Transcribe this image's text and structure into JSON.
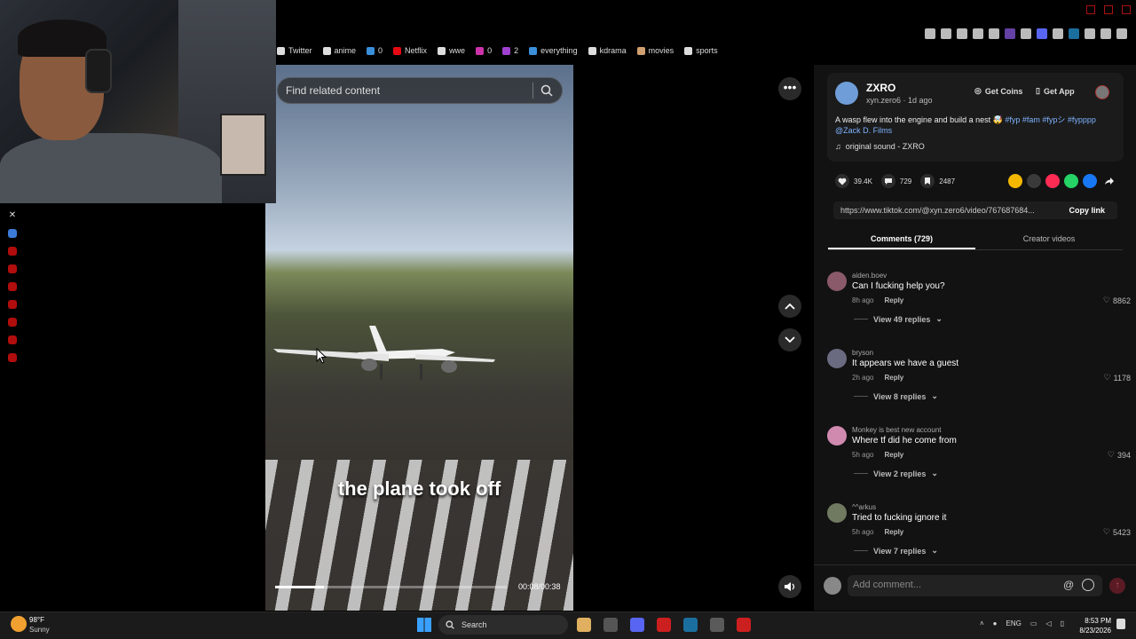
{
  "bookmarks": [
    {
      "label": "Twitter",
      "icon": "x-icon",
      "color": "#dddddd"
    },
    {
      "label": "anime",
      "icon": "anime-icon",
      "color": "#dddddd"
    },
    {
      "label": "0",
      "icon": "mail-icon",
      "color": "#3a8fd8"
    },
    {
      "label": "Netflix",
      "icon": "netflix-icon",
      "color": "#e50914"
    },
    {
      "label": "wwe",
      "icon": "doc-icon",
      "color": "#dddddd"
    },
    {
      "label": "0",
      "icon": "doc-icon",
      "color": "#cc33aa"
    },
    {
      "label": "2",
      "icon": "gem-icon",
      "color": "#a040d0"
    },
    {
      "label": "everything",
      "icon": "bar-icon",
      "color": "#3a8fd8"
    },
    {
      "label": "kdrama",
      "icon": "dots-icon",
      "color": "#dddddd"
    },
    {
      "label": "movies",
      "icon": "theater-icon",
      "color": "#d0a070"
    },
    {
      "label": "sports",
      "icon": "trophy-icon",
      "color": "#dddddd"
    }
  ],
  "video": {
    "search_placeholder": "Find related content",
    "caption": "the plane took off",
    "time": "00:08/00:38",
    "progress": 0.21
  },
  "author": {
    "name": "ZXRO",
    "handle_time": "xyn.zero6 · 1d ago"
  },
  "header_actions": {
    "get_coins": "Get Coins",
    "get_app": "Get App"
  },
  "description": {
    "text": "A wasp flew into the engine and build a nest 🤯 ",
    "tags": "#fyp #fam #fypシ #fypppp @Zack D. Films"
  },
  "sound": "original sound - ZXRO",
  "stats": {
    "likes": "39.4K",
    "comments": "729",
    "saves": "2487"
  },
  "share_colors": [
    "#f5b800",
    "#3a3a3a",
    "#fe2c55",
    "#25d366",
    "#1877f2"
  ],
  "link": {
    "url": "https://www.tiktok.com/@xyn.zero6/video/767687684...",
    "copy_label": "Copy link"
  },
  "tabs": {
    "comments": "Comments (729)",
    "creator": "Creator videos"
  },
  "comments": [
    {
      "user": "aiden.boev",
      "text": "Can I fucking help you?",
      "time": "8h ago",
      "reply": "Reply",
      "likes": "8862",
      "view": "View 49 replies",
      "avatar_color": "#8a5a6a"
    },
    {
      "user": "bryson",
      "text": "It appears we have a guest",
      "time": "2h ago",
      "reply": "Reply",
      "likes": "1178",
      "view": "View 8 replies",
      "avatar_color": "#6a6a80"
    },
    {
      "user": "Monkey is best new account",
      "text": "Where tf did he come from",
      "time": "5h ago",
      "reply": "Reply",
      "likes": "394",
      "view": "View 2 replies",
      "avatar_color": "#d08ab0"
    },
    {
      "user": "^^arkus",
      "text": "Tried to fucking ignore it",
      "time": "5h ago",
      "reply": "Reply",
      "likes": "5423",
      "view": "View 7 replies",
      "avatar_color": "#707a60"
    }
  ],
  "comment_bar": {
    "placeholder": "Add comment..."
  },
  "taskbar": {
    "temp": "98°F",
    "condition": "Sunny",
    "search": "Search",
    "lang": "ENG",
    "time": "8:53 PM",
    "date": "8/23/2026"
  },
  "taskbar_app_colors": [
    "#e0b060",
    "#555555",
    "#5865f2",
    "#cc1f1f",
    "#1b6f9e",
    "#5a5a5a",
    "#cc1f1f"
  ]
}
